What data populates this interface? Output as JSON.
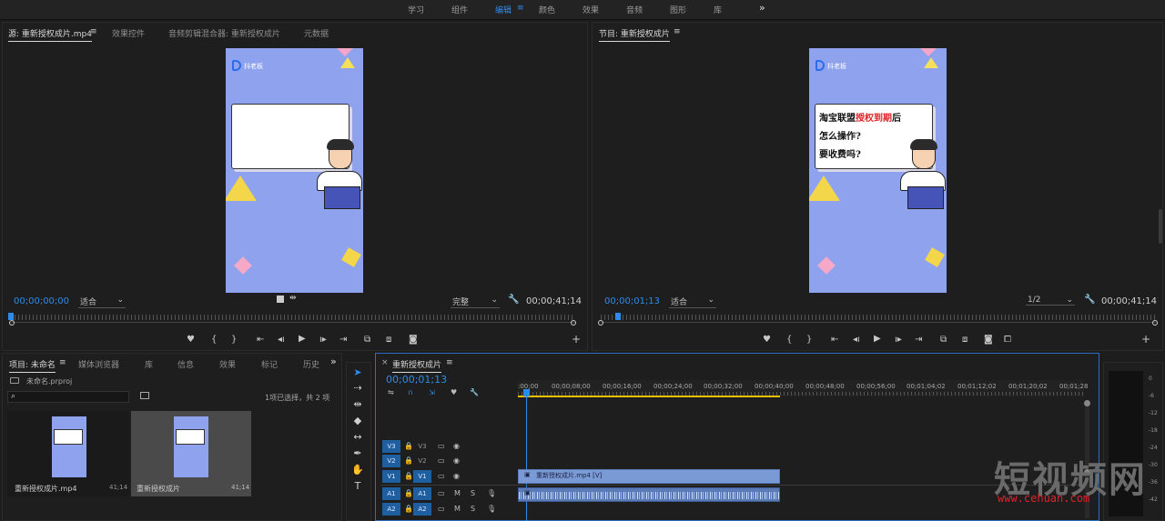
{
  "workspace": {
    "tabs": [
      "学习",
      "组件",
      "编辑",
      "颜色",
      "效果",
      "音频",
      "图形",
      "库"
    ],
    "active": "编辑",
    "more": "»",
    "menu_icon": "≡"
  },
  "source_monitor": {
    "tabs": [
      "源: 重新授权成片.mp4",
      "效果控件",
      "音频剪辑混合器: 重新授权成片",
      "元数据"
    ],
    "menu_icon": "≡",
    "timecode": "00;00;00;00",
    "fit": "适合",
    "quality": "完整",
    "duration": "00;00;41;14",
    "frame_brand": "抖老板"
  },
  "program_monitor": {
    "tab": "节目: 重新授权成片",
    "menu_icon": "≡",
    "timecode": "00;00;01;13",
    "fit": "适合",
    "quality": "1/2",
    "duration": "00;00;41;14",
    "frame_brand": "抖老板",
    "board_line1_a": "淘宝联盟",
    "board_line1_red": "授权到期",
    "board_line1_b": "后",
    "board_line2": "怎么操作?",
    "board_line3": "要收费吗?"
  },
  "project_panel": {
    "tabs": [
      "项目: 未命名",
      "媒体浏览器",
      "库",
      "信息",
      "效果",
      "标记",
      "历史"
    ],
    "menu_icon": "≡",
    "file": "未命名.prproj",
    "selection": "1项已选择，共 2 项",
    "more": "»",
    "items": [
      {
        "name": "重新授权成片.mp4",
        "duration": "41;14"
      },
      {
        "name": "重新授权成片",
        "duration": "41;14"
      }
    ]
  },
  "timeline": {
    "tab": "重新授权成片",
    "menu_icon": "≡",
    "close": "×",
    "timecode": "00;00;01;13",
    "ticks": [
      ":00;00",
      "00;00;08;00",
      "00;00;16;00",
      "00;00;24;00",
      "00;00;32;00",
      "00;00;40;00",
      "00;00;48;00",
      "00;00;56;00",
      "00;01;04;02",
      "00;01;12;02",
      "00;01;20;02",
      "00;01;28"
    ],
    "tracks": [
      {
        "src": "V3",
        "name": "V3"
      },
      {
        "src": "V2",
        "name": "V2"
      },
      {
        "src": "V1",
        "name": "V1"
      },
      {
        "src": "A1",
        "name": "A1"
      },
      {
        "src": "A2",
        "name": "A2"
      }
    ],
    "mute": "M",
    "solo": "S",
    "video_clip": "重新授权成片.mp4 [V]"
  },
  "meters": [
    "0",
    "-6",
    "-12",
    "-18",
    "-24",
    "-30",
    "-36",
    "-42"
  ],
  "watermark": {
    "title": "短视频网",
    "url": "www.cehuan.com"
  }
}
